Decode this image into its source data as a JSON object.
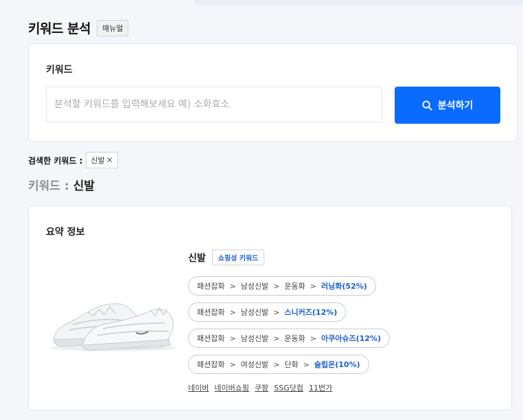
{
  "header": {
    "title": "키워드 분석",
    "manual_label": "매뉴얼"
  },
  "search": {
    "label": "키워드",
    "placeholder": "분석할 키워드를 입력해보세요 예) 소화효소",
    "value": "",
    "button_label": "분석하기"
  },
  "searched": {
    "label": "검색한 키워드 :",
    "chips": [
      {
        "label": "신발",
        "remove_icon": "close-icon"
      }
    ]
  },
  "keyword_heading": {
    "prefix": "키워드 :",
    "value": "신발"
  },
  "summary": {
    "title": "요약 정보",
    "product_name": "신발",
    "badge": "쇼핑성 키워드",
    "image": "white-sneaker-image",
    "categories": [
      {
        "path": [
          "패션잡화",
          "남성신발",
          "운동화"
        ],
        "leaf": "러닝화(52%)"
      },
      {
        "path": [
          "패션잡화",
          "남성신발"
        ],
        "leaf": "스니커즈(12%)"
      },
      {
        "path": [
          "패션잡화",
          "남성신발",
          "운동화"
        ],
        "leaf": "아쿠아슈즈(12%)"
      },
      {
        "path": [
          "패션잡화",
          "여성신발",
          "단화"
        ],
        "leaf": "슬립온(10%)"
      }
    ],
    "separator": ">",
    "links": [
      "네이버",
      "네이버쇼핑",
      "쿠팡",
      "SSG닷컴",
      "11번가"
    ]
  },
  "colors": {
    "accent": "#0a6cff",
    "link_blue": "#1a5fd0",
    "background": "#f4f6fa"
  }
}
